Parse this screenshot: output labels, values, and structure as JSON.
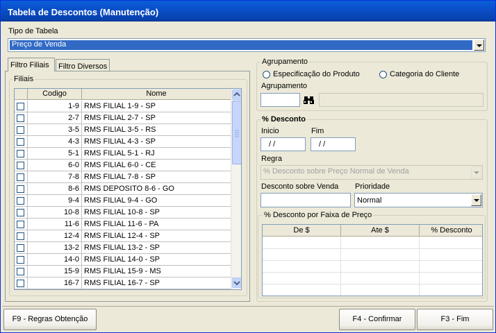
{
  "window": {
    "title": "Tabela de Descontos (Manutenção)"
  },
  "tipo_tabela": {
    "label": "Tipo de Tabela",
    "value": "Preço de Venda"
  },
  "tabs": [
    {
      "label": "Filtro Filiais"
    },
    {
      "label": "Filtro Diversos"
    }
  ],
  "filiais": {
    "group_title": "Filiais",
    "columns": {
      "codigo": "Codigo",
      "nome": "Nome"
    },
    "rows": [
      {
        "codigo": "1-9",
        "nome": "RMS FILIAL 1-9 - SP"
      },
      {
        "codigo": "2-7",
        "nome": "RMS FILIAL 2-7 - SP"
      },
      {
        "codigo": "3-5",
        "nome": "RMS FILIAL 3-5 - RS"
      },
      {
        "codigo": "4-3",
        "nome": "RMS FILIAL 4-3 - SP"
      },
      {
        "codigo": "5-1",
        "nome": "RMS FILIAL 5-1 - RJ"
      },
      {
        "codigo": "6-0",
        "nome": "RMS FILIAL 6-0 - CE"
      },
      {
        "codigo": "7-8",
        "nome": "RMS FILIAL 7-8 - SP"
      },
      {
        "codigo": "8-6",
        "nome": "RMS DEPOSITO 8-6 - GO"
      },
      {
        "codigo": "9-4",
        "nome": "RMS FILIAL 9-4 - GO"
      },
      {
        "codigo": "10-8",
        "nome": "RMS FILIAL 10-8 - SP"
      },
      {
        "codigo": "11-6",
        "nome": "RMS FILIAL 11-6 - PA"
      },
      {
        "codigo": "12-4",
        "nome": "RMS FILIAL 12-4 - SP"
      },
      {
        "codigo": "13-2",
        "nome": "RMS FILIAL 13-2 - SP"
      },
      {
        "codigo": "14-0",
        "nome": "RMS FILIAL 14-0 - SP"
      },
      {
        "codigo": "15-9",
        "nome": "RMS FILIAL 15-9 - MS"
      },
      {
        "codigo": "16-7",
        "nome": "RMS FILIAL 16-7 - SP"
      }
    ]
  },
  "agrupamento": {
    "group_title": "Agrupamento",
    "option_especificacao": "Especificação do Produto",
    "option_categoria": "Categoria do Cliente",
    "field_label": "Agrupamento",
    "code_value": "",
    "desc_value": ""
  },
  "desconto": {
    "group_title": "% Desconto",
    "inicio_label": "Inicio",
    "inicio_value": " / /",
    "fim_label": "Fim",
    "fim_value": " / /",
    "regra_label": "Regra",
    "regra_value": "% Desconto sobre Preço Normal de Venda",
    "desc_venda_label": "Desconto sobre Venda",
    "desc_venda_value": "",
    "prioridade_label": "Prioridade",
    "prioridade_value": "Normal"
  },
  "faixa": {
    "group_title": "% Desconto por Faixa de Preço",
    "columns": {
      "de": "De $",
      "ate": "Ate $",
      "desconto": "% Desconto"
    }
  },
  "buttons": {
    "regras": "F9 - Regras Obtenção",
    "confirmar": "F4 - Confirmar",
    "fim": "F3 - Fim"
  },
  "colors": {
    "title_bar": "#0a4fc9",
    "selection": "#316ac5",
    "background": "#ece9d8"
  }
}
